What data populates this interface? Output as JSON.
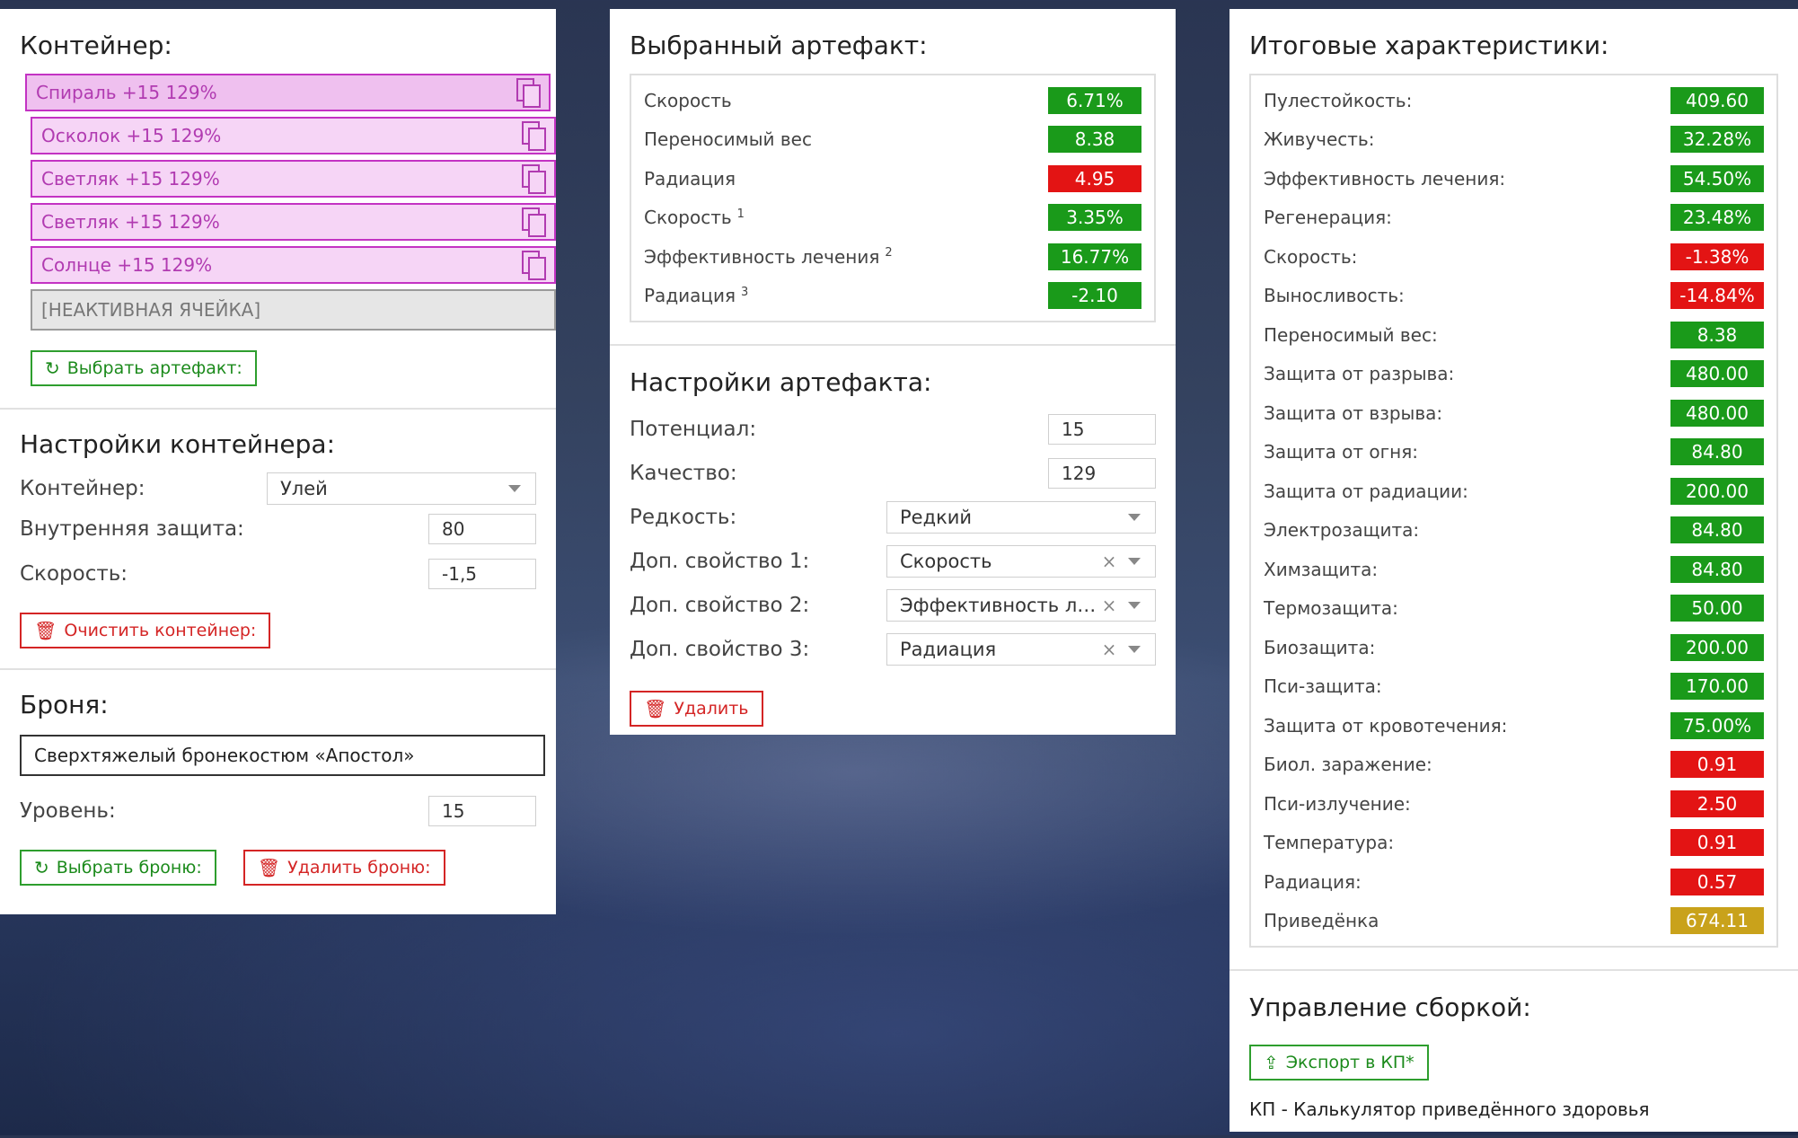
{
  "left": {
    "container_title": "Контейнер:",
    "slots": [
      {
        "label": "Спираль +15 129%"
      },
      {
        "label": "Осколок +15 129%"
      },
      {
        "label": "Светляк +15 129%"
      },
      {
        "label": "Светляк +15 129%"
      },
      {
        "label": "Солнце +15 129%"
      }
    ],
    "inactive_slot": "[НЕАКТИВНАЯ ЯЧЕЙКА]",
    "choose_artifact_btn": "Выбрать артефакт:",
    "settings_title": "Настройки контейнера:",
    "container_label": "Контейнер:",
    "container_value": "Улей",
    "inner_protection_label": "Внутренняя защита:",
    "inner_protection_value": "80",
    "speed_label": "Скорость:",
    "speed_value": "-1,5",
    "clear_btn": "Очистить контейнер:",
    "armor_title": "Броня:",
    "armor_value": "Сверхтяжелый бронекостюм «Апостол»",
    "level_label": "Уровень:",
    "level_value": "15",
    "choose_armor_btn": "Выбрать броню:",
    "delete_armor_btn": "Удалить броню:"
  },
  "middle": {
    "selected_title": "Выбранный артефакт:",
    "stats": [
      {
        "name": "Скорость",
        "sup": "",
        "value": "6.71%",
        "status": "g"
      },
      {
        "name": "Переносимый вес",
        "sup": "",
        "value": "8.38",
        "status": "g"
      },
      {
        "name": "Радиация",
        "sup": "",
        "value": "4.95",
        "status": "r"
      },
      {
        "name": "Скорость",
        "sup": "1",
        "value": "3.35%",
        "status": "g"
      },
      {
        "name": "Эффективность лечения",
        "sup": "2",
        "value": "16.77%",
        "status": "g"
      },
      {
        "name": "Радиация",
        "sup": "3",
        "value": "-2.10",
        "status": "g"
      }
    ],
    "settings_title": "Настройки артефакта:",
    "potential_label": "Потенциал:",
    "potential_value": "15",
    "quality_label": "Качество:",
    "quality_value": "129",
    "rarity_label": "Редкость:",
    "rarity_value": "Редкий",
    "prop1_label": "Доп. свойство 1:",
    "prop1_value": "Скорость",
    "prop2_label": "Доп. свойство 2:",
    "prop2_value": "Эффективность ле...",
    "prop3_label": "Доп. свойство 3:",
    "prop3_value": "Радиация",
    "clear_symbol": "×",
    "delete_btn": "Удалить"
  },
  "right": {
    "totals_title": "Итоговые характеристики:",
    "totals": [
      {
        "name": "Пулестойкость:",
        "value": "409.60",
        "status": "g"
      },
      {
        "name": "Живучесть:",
        "value": "32.28%",
        "status": "g"
      },
      {
        "name": "Эффективность лечения:",
        "value": "54.50%",
        "status": "g"
      },
      {
        "name": "Регенерация:",
        "value": "23.48%",
        "status": "g"
      },
      {
        "name": "Скорость:",
        "value": "-1.38%",
        "status": "r"
      },
      {
        "name": "Выносливость:",
        "value": "-14.84%",
        "status": "r"
      },
      {
        "name": "Переносимый вес:",
        "value": "8.38",
        "status": "g"
      },
      {
        "name": "Защита от разрыва:",
        "value": "480.00",
        "status": "g"
      },
      {
        "name": "Защита от взрыва:",
        "value": "480.00",
        "status": "g"
      },
      {
        "name": "Защита от огня:",
        "value": "84.80",
        "status": "g"
      },
      {
        "name": "Защита от радиации:",
        "value": "200.00",
        "status": "g"
      },
      {
        "name": "Электрозащита:",
        "value": "84.80",
        "status": "g"
      },
      {
        "name": "Химзащита:",
        "value": "84.80",
        "status": "g"
      },
      {
        "name": "Термозащита:",
        "value": "50.00",
        "status": "g"
      },
      {
        "name": "Биозащита:",
        "value": "200.00",
        "status": "g"
      },
      {
        "name": "Пси-защита:",
        "value": "170.00",
        "status": "g"
      },
      {
        "name": "Защита от кровотечения:",
        "value": "75.00%",
        "status": "g"
      },
      {
        "name": "Биол. заражение:",
        "value": "0.91",
        "status": "r"
      },
      {
        "name": "Пси-излучение:",
        "value": "2.50",
        "status": "r"
      },
      {
        "name": "Температура:",
        "value": "0.91",
        "status": "r"
      },
      {
        "name": "Радиация:",
        "value": "0.57",
        "status": "r"
      },
      {
        "name": "Приведёнка",
        "value": "674.11",
        "status": "y"
      }
    ],
    "build_title": "Управление сборкой:",
    "export_btn": "Экспорт в КП*",
    "footnote": "КП - Калькулятор приведённого здоровья"
  },
  "colors": {
    "green": "#1a9a1a",
    "red": "#e31414",
    "yellow": "#c9a21b",
    "slot_border": "#c333c3"
  },
  "icons": {
    "refresh": "refresh-icon",
    "trash": "trash-icon",
    "copy": "copy-icon",
    "upload": "upload-icon"
  }
}
